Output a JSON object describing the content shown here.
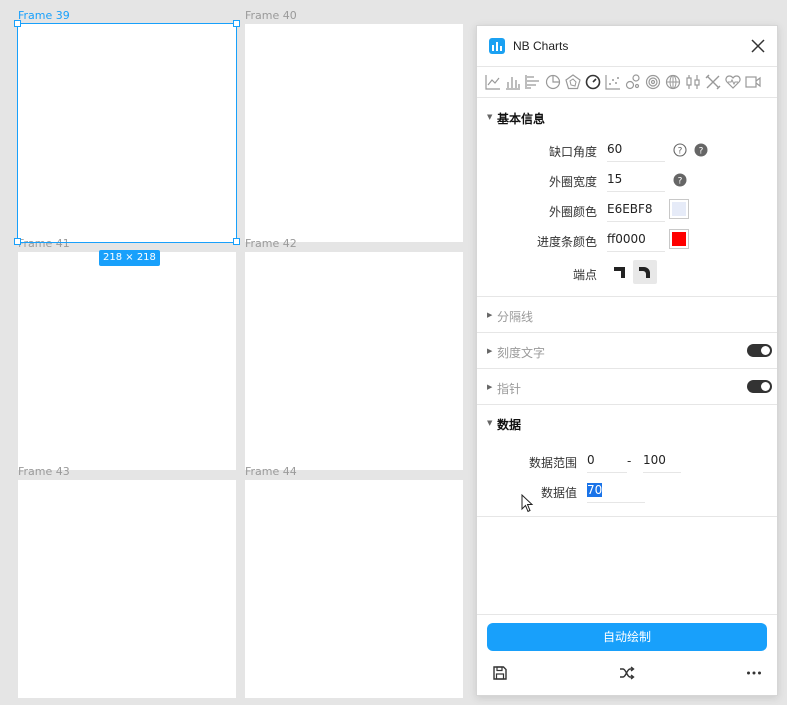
{
  "canvas": {
    "frames": [
      {
        "label": "Frame 39"
      },
      {
        "label": "Frame 40"
      },
      {
        "label": "Frame 41"
      },
      {
        "label": "Frame 42"
      },
      {
        "label": "Frame 43"
      },
      {
        "label": "Frame 44"
      }
    ],
    "selection_size": "218 × 218",
    "accent": "#18a0fb"
  },
  "plugin": {
    "title": "NB Charts",
    "chart_types": [
      "line-chart-icon",
      "bar-chart-icon",
      "horizontal-bar-icon",
      "pie-chart-icon",
      "radar-chart-icon",
      "gauge-chart-icon",
      "scatter-chart-icon",
      "bubble-chart-icon",
      "ring-chart-icon",
      "polar-chart-icon",
      "candlestick-icon",
      "tools-icon",
      "heart-chart-icon",
      "video-icon"
    ],
    "basic": {
      "title": "基本信息",
      "gap_angle_label": "缺口角度",
      "gap_angle_value": "60",
      "outer_width_label": "外圈宽度",
      "outer_width_value": "15",
      "outer_color_label": "外圈颜色",
      "outer_color_value": "E6EBF8",
      "outer_color_hex": "#E6EBF8",
      "progress_color_label": "进度条颜色",
      "progress_color_value": "ff0000",
      "progress_color_hex": "#ff0000",
      "endpoint_label": "端点"
    },
    "sections": {
      "divider": "分隔线",
      "tick_text": "刻度文字",
      "pointer": "指针",
      "data": "数据"
    },
    "data": {
      "range_label": "数据范围",
      "range_min": "0",
      "range_sep": "-",
      "range_max": "100",
      "value_label": "数据值",
      "value": "70"
    },
    "auto_draw": "自动绘制"
  }
}
